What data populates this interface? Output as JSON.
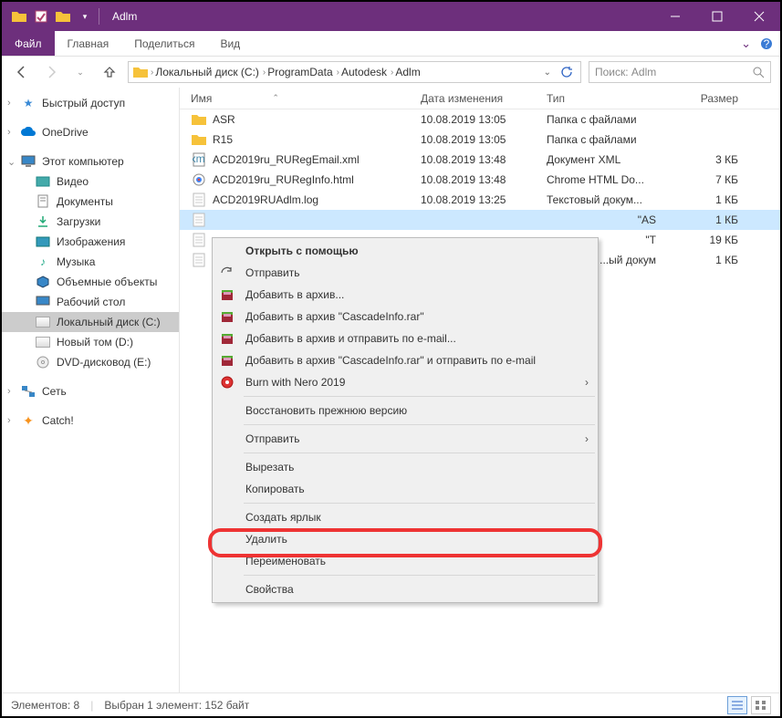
{
  "titlebar": {
    "title": "Adlm"
  },
  "ribbon": {
    "tabs": [
      "Файл",
      "Главная",
      "Поделиться",
      "Вид"
    ]
  },
  "crumbs": [
    "Локальный диск (C:)",
    "ProgramData",
    "Autodesk",
    "Adlm"
  ],
  "search": {
    "placeholder": "Поиск: Adlm"
  },
  "sidebar": {
    "quick": "Быстрый доступ",
    "onedrive": "OneDrive",
    "thispc": "Этот компьютер",
    "pcitems": [
      "Видео",
      "Документы",
      "Загрузки",
      "Изображения",
      "Музыка",
      "Объемные объекты",
      "Рабочий стол",
      "Локальный диск (C:)",
      "Новый том (D:)",
      "DVD-дисковод (E:)"
    ],
    "network": "Сеть",
    "catch": "Catch!"
  },
  "columns": {
    "name": "Имя",
    "date": "Дата изменения",
    "type": "Тип",
    "size": "Размер"
  },
  "files": [
    {
      "name": "ASR",
      "date": "10.08.2019 13:05",
      "type": "Папка с файлами",
      "size": "",
      "icon": "folder"
    },
    {
      "name": "R15",
      "date": "10.08.2019 13:05",
      "type": "Папка с файлами",
      "size": "",
      "icon": "folder"
    },
    {
      "name": "ACD2019ru_RURegEmail.xml",
      "date": "10.08.2019 13:48",
      "type": "Документ XML",
      "size": "3 КБ",
      "icon": "xml"
    },
    {
      "name": "ACD2019ru_RURegInfo.html",
      "date": "10.08.2019 13:48",
      "type": "Chrome HTML Do...",
      "size": "7 КБ",
      "icon": "html"
    },
    {
      "name": "ACD2019RUAdlm.log",
      "date": "10.08.2019 13:25",
      "type": "Текстовый докум...",
      "size": "1 КБ",
      "icon": "txt"
    }
  ],
  "partialrows": [
    {
      "type_suffix": "AS\"",
      "size": "1 КБ",
      "sel": true
    },
    {
      "type_suffix": "T\"",
      "size": "19 КБ",
      "sel": false
    },
    {
      "type_suffix": "ый докум...",
      "size": "1 КБ",
      "sel": false
    }
  ],
  "contextmenu": {
    "open_with": "Открыть с помощью",
    "send": "Отправить",
    "archive_add": "Добавить в архив...",
    "archive_cascade": "Добавить в архив \"CascadeInfo.rar\"",
    "archive_email": "Добавить в архив и отправить по e-mail...",
    "archive_cascade_email": "Добавить в архив \"CascadeInfo.rar\" и отправить по e-mail",
    "burn": "Burn with Nero 2019",
    "restore": "Восстановить прежнюю версию",
    "send_to": "Отправить",
    "cut": "Вырезать",
    "copy": "Копировать",
    "shortcut": "Создать ярлык",
    "delete": "Удалить",
    "rename": "Переименовать",
    "properties": "Свойства"
  },
  "statusbar": {
    "count": "Элементов: 8",
    "selection": "Выбран 1 элемент: 152 байт"
  }
}
